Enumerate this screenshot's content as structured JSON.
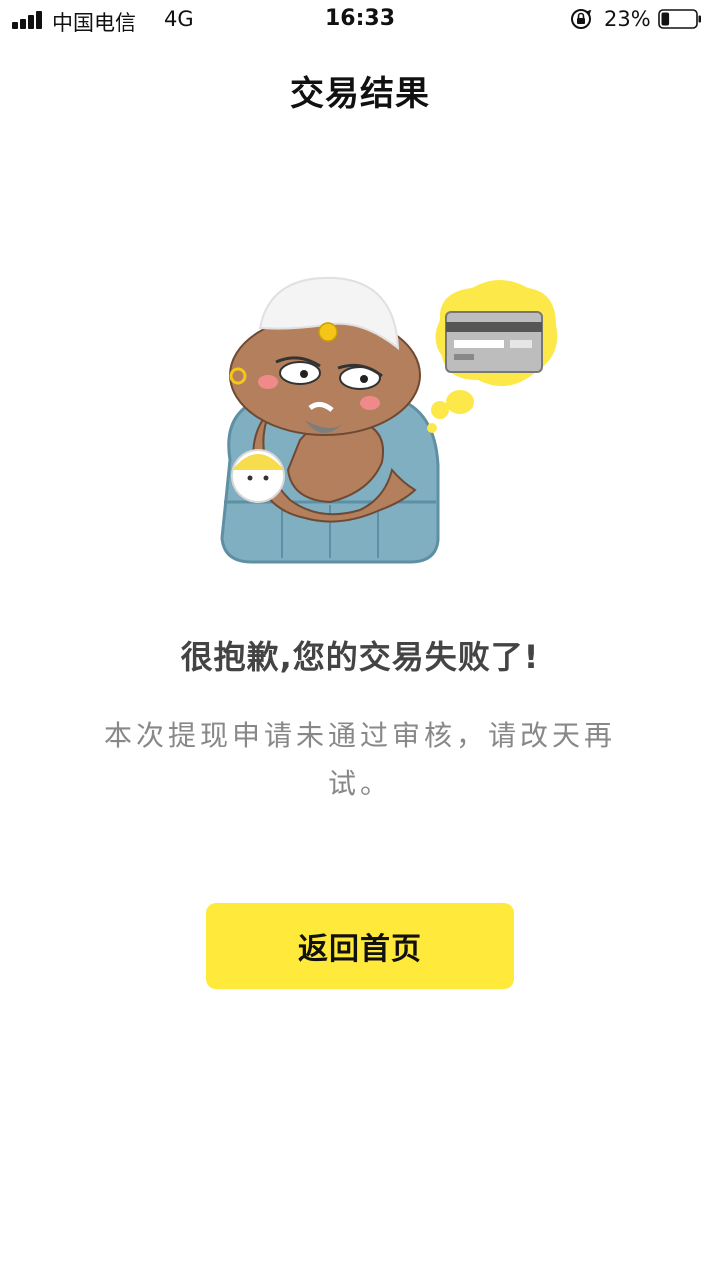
{
  "status_bar": {
    "carrier": "中国电信",
    "network": "4G",
    "time": "16:33",
    "battery_percent": "23%",
    "battery_level": 0.23,
    "signal_icon": "signal-bars-icon",
    "lock_icon": "orientation-lock-icon",
    "battery_icon": "battery-icon"
  },
  "header": {
    "title": "交易结果"
  },
  "result": {
    "illustration": "failed-transaction-illustration",
    "heading": "很抱歉,您的交易失败了!",
    "message": "本次提现申请未通过审核，请改天再试。"
  },
  "actions": {
    "home_button_label": "返回首页"
  },
  "colors": {
    "accent": "#ffe93a",
    "heading": "#444444",
    "message": "#888888"
  }
}
